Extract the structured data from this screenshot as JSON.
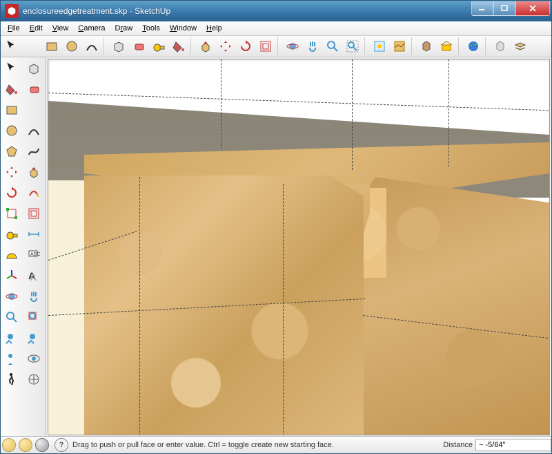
{
  "titlebar": {
    "title": "enclosureedgetreatment.skp - SketchUp"
  },
  "menus": [
    "File",
    "Edit",
    "View",
    "Camera",
    "Draw",
    "Tools",
    "Window",
    "Help"
  ],
  "toolbar_top": [
    {
      "name": "select-tool"
    },
    {
      "name": "line-tool"
    },
    {
      "name": "rectangle-tool"
    },
    {
      "name": "circle-tool"
    },
    {
      "name": "arc-tool"
    },
    {
      "sep": true
    },
    {
      "name": "make-component"
    },
    {
      "name": "eraser-tool"
    },
    {
      "name": "tape-measure-tool"
    },
    {
      "name": "paint-bucket-tool"
    },
    {
      "sep": true
    },
    {
      "name": "push-pull-tool"
    },
    {
      "name": "move-tool"
    },
    {
      "name": "rotate-tool"
    },
    {
      "name": "offset-tool"
    },
    {
      "sep": true
    },
    {
      "name": "orbit-tool"
    },
    {
      "name": "pan-tool"
    },
    {
      "name": "zoom-tool"
    },
    {
      "name": "zoom-extents-tool"
    },
    {
      "sep": true
    },
    {
      "name": "add-location"
    },
    {
      "name": "toggle-terrain"
    },
    {
      "sep": true
    },
    {
      "name": "photo-textures"
    },
    {
      "name": "3d-warehouse"
    },
    {
      "sep": true
    },
    {
      "name": "preview-google-earth"
    },
    {
      "sep": true
    },
    {
      "name": "extension-warehouse"
    },
    {
      "name": "layers-button"
    }
  ],
  "toolbar_left": [
    [
      "select-tool",
      "make-component"
    ],
    [
      "paint-bucket-tool",
      "eraser-tool"
    ],
    [
      "rectangle-tool",
      "line-tool"
    ],
    [
      "circle-tool",
      "arc-tool"
    ],
    [
      "polygon-tool",
      "freehand-tool"
    ],
    [
      "move-tool",
      "push-pull-tool"
    ],
    [
      "rotate-tool",
      "follow-me-tool"
    ],
    [
      "scale-tool",
      "offset-tool"
    ],
    [
      "tape-measure-tool",
      "dimension-tool"
    ],
    [
      "protractor-tool",
      "text-tool"
    ],
    [
      "axes-tool",
      "3d-text-tool"
    ],
    [
      "orbit-tool",
      "pan-tool"
    ],
    [
      "zoom-tool",
      "zoom-window-tool"
    ],
    [
      "previous-view-tool",
      "next-view-tool"
    ],
    [
      "position-camera-tool",
      "look-around-tool"
    ],
    [
      "walk-tool",
      "section-plane-tool"
    ]
  ],
  "statusbar": {
    "hint": "Drag to push or pull face or enter value.  Ctrl = toggle create new starting face.",
    "measurement_label": "Distance",
    "measurement_value": "~ -5/64\""
  }
}
